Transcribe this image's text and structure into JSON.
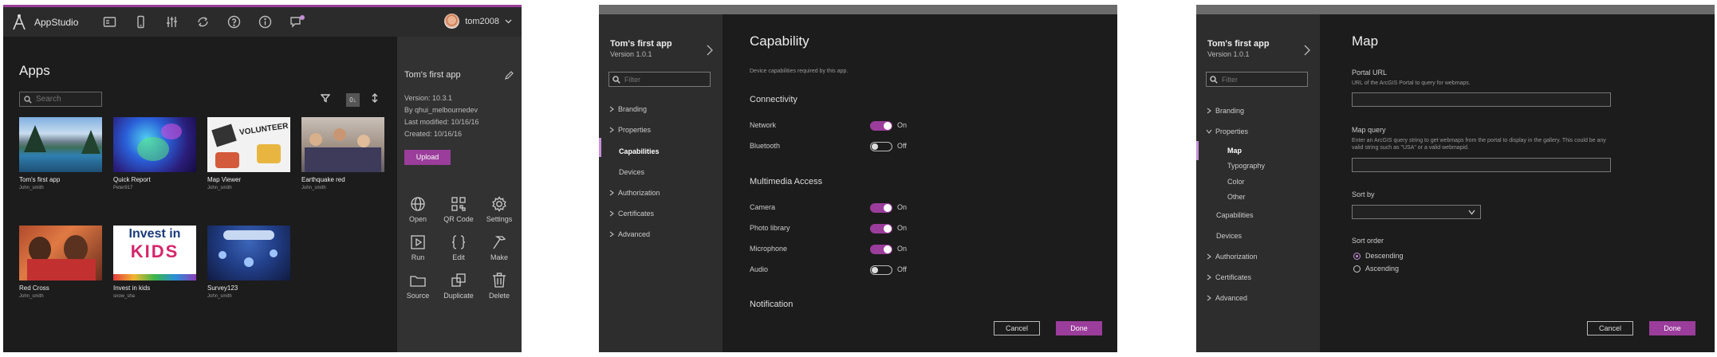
{
  "panel1": {
    "brand": "AppStudio",
    "user": "tom2008",
    "apps_title": "Apps",
    "search_placeholder": "Search",
    "sort_label": "0↓",
    "apps": [
      {
        "name": "Tom's first app",
        "owner": "John_smith"
      },
      {
        "name": "Quick Report",
        "owner": "Peter917"
      },
      {
        "name": "Map Viewer",
        "owner": "John_smith"
      },
      {
        "name": "Earthquake red",
        "owner": "John_smith"
      },
      {
        "name": "Red Cross",
        "owner": "John_smith"
      },
      {
        "name": "Invest in kids",
        "owner": "snow_sha"
      },
      {
        "name": "Survey123",
        "owner": "John_smith"
      }
    ],
    "invest_text_1": "Invest in",
    "invest_text_2": "KIDS",
    "volunteer_text": "VOLUNTEER",
    "details": {
      "title": "Tom's first app",
      "version": "Version: 10.3.1",
      "by": "By qhui_melbournedev",
      "modified": "Last modified: 10/16/16",
      "created": "Created: 10/16/16",
      "upload": "Upload"
    },
    "actions": [
      "Open",
      "QR Code",
      "Settings",
      "Run",
      "Edit",
      "Make",
      "Source",
      "Duplicate",
      "Delete"
    ]
  },
  "panel2": {
    "app_title": "Tom's first app",
    "app_version": "Version 1.0.1",
    "filter_placeholder": "Filter",
    "nav": [
      "Branding",
      "Properties",
      "Capabilities",
      "Devices",
      "Authorization",
      "Certificates",
      "Advanced"
    ],
    "title": "Capability",
    "desc": "Device capabilities required by this app.",
    "sections": {
      "connectivity": "Connectivity",
      "multimedia": "Multimedia Access",
      "notification": "Notification"
    },
    "rows": [
      {
        "label": "Network",
        "state": "On"
      },
      {
        "label": "Bluetooth",
        "state": "Off"
      },
      {
        "label": "Camera",
        "state": "On"
      },
      {
        "label": "Photo library",
        "state": "On"
      },
      {
        "label": "Microphone",
        "state": "On"
      },
      {
        "label": "Audio",
        "state": "Off"
      }
    ],
    "cancel": "Cancel",
    "done": "Done"
  },
  "panel3": {
    "app_title": "Tom's first app",
    "app_version": "Version 1.0.1",
    "filter_placeholder": "Filter",
    "nav": {
      "branding": "Branding",
      "properties": "Properties",
      "map": "Map",
      "typography": "Typography",
      "color": "Color",
      "other": "Other",
      "capabilities": "Capabilities",
      "devices": "Devices",
      "authorization": "Authorization",
      "certificates": "Certificates",
      "advanced": "Advanced"
    },
    "title": "Map",
    "portal_label": "Portal URL",
    "portal_help": "URL of the ArcGIS Portal to query for webmaps.",
    "query_label": "Map query",
    "query_help": "Enter an ArcGIS query string to get webmaps from the portal to display in the gallery. This could be any valid string such as \"USA\" or a valid webmapid.",
    "sortby_label": "Sort by",
    "sortorder_label": "Sort order",
    "descending": "Descending",
    "ascending": "Ascending",
    "cancel": "Cancel",
    "done": "Done"
  },
  "colors": {
    "accent": "#9b3d9b",
    "accent_light": "#c58fd6",
    "bg": "#1c1c1c",
    "sidebar": "#2d2d2d"
  }
}
